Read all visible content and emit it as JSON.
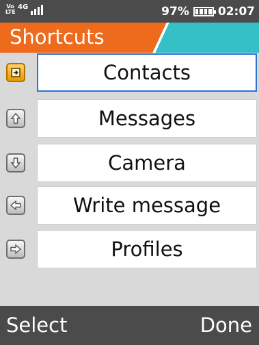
{
  "status_bar": {
    "volte": "Vo LTE",
    "network": "4G",
    "battery_percent": "97%",
    "time": "02:07",
    "signal_bars": 4,
    "battery_level": 1.0
  },
  "header": {
    "title": "Shortcuts"
  },
  "items": [
    {
      "label": "Contacts",
      "icon": "dpad-center-key-icon",
      "selected": true
    },
    {
      "label": "Messages",
      "icon": "dpad-up-key-icon",
      "selected": false
    },
    {
      "label": "Camera",
      "icon": "dpad-down-key-icon",
      "selected": false
    },
    {
      "label": "Write message",
      "icon": "dpad-left-key-icon",
      "selected": false
    },
    {
      "label": "Profiles",
      "icon": "dpad-right-key-icon",
      "selected": false
    }
  ],
  "softkeys": {
    "left": "Select",
    "right": "Done"
  },
  "colors": {
    "header_accent": "#ee6a1c",
    "header_secondary": "#35c0c8",
    "selection_border": "#2e73d2",
    "bars": "#4b4b4b"
  }
}
